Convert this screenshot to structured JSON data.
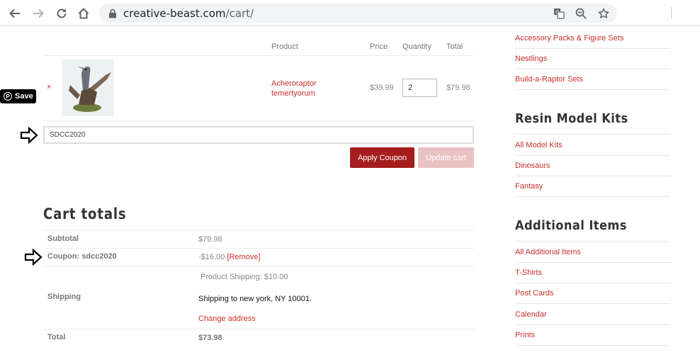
{
  "browser": {
    "url_domain": "creative-beast.com",
    "url_path": "/cart/"
  },
  "cart": {
    "headers": {
      "product": "Product",
      "price": "Price",
      "quantity": "Quantity",
      "total": "Total"
    },
    "item": {
      "remove": "×",
      "name_line1": "Acheroraptor",
      "name_line2": "temertyorum",
      "price": "$39.99",
      "quantity": "2",
      "total": "$79.98"
    },
    "coupon_value": "SDCC2020",
    "apply_label": "Apply Coupon",
    "update_label": "Update cart"
  },
  "pinterest": {
    "save_label": "Save"
  },
  "totals": {
    "title": "Cart totals",
    "subtotal_label": "Subtotal",
    "subtotal_value": "$79.98",
    "coupon_label": "Coupon: sdcc2020",
    "coupon_value": "-$16.00",
    "coupon_remove": "[Remove]",
    "product_shipping": "Product Shipping: $10.00",
    "shipping_label": "Shipping",
    "shipping_to": "Shipping to new york, NY 10001.",
    "change_address": "Change address",
    "total_label": "Total",
    "total_value": "$73.98"
  },
  "sidebar": {
    "top_links": [
      "Accessory Packs & Figure Sets",
      "Nestlings",
      "Build-a-Raptor Sets"
    ],
    "resin_title": "Resin Model Kits",
    "resin_links": [
      "All Model Kits",
      "Dinosaurs",
      "Fantasy"
    ],
    "additional_title": "Additional Items",
    "additional_links": [
      "All Additional Items",
      "T-Shirts",
      "Post Cards",
      "Calendar",
      "Prints"
    ]
  },
  "colors": {
    "accent": "#c9302c",
    "apply_button": "#a51d1d",
    "update_button_disabled": "#e9c3c3"
  }
}
